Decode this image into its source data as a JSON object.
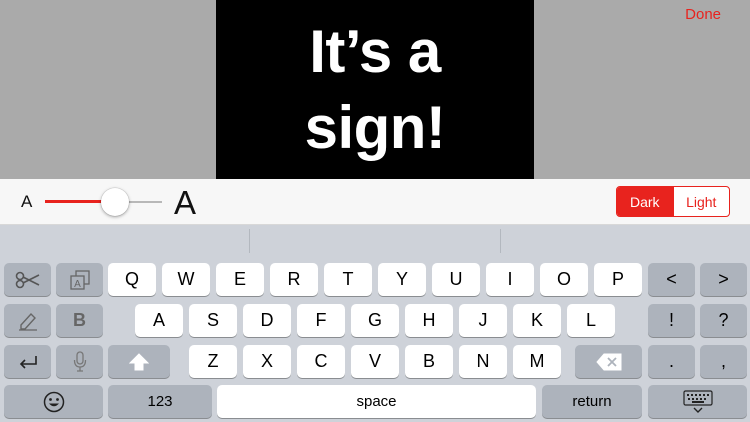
{
  "sign": {
    "text": "It’s a\nsign!"
  },
  "header": {
    "done_label": "Done"
  },
  "font_size_control": {
    "small_label": "A",
    "large_label": "A",
    "level": 0.6
  },
  "theme": {
    "dark_label": "Dark",
    "light_label": "Light",
    "selected": "Dark"
  },
  "keyboard": {
    "row1": [
      "Q",
      "W",
      "E",
      "R",
      "T",
      "Y",
      "U",
      "I",
      "O",
      "P"
    ],
    "row2": [
      "A",
      "S",
      "D",
      "F",
      "G",
      "H",
      "J",
      "K",
      "L"
    ],
    "row3": [
      "Z",
      "X",
      "C",
      "V",
      "B",
      "N",
      "M"
    ],
    "bold_label": "B",
    "exclaim_label": "!",
    "question_label": "?",
    "period_label": ".",
    "comma_label": ",",
    "numbers_label": "123",
    "space_label": "space",
    "return_label": "return",
    "left_arrow": "<",
    "right_arrow": ">"
  },
  "colors": {
    "accent": "#e8231e",
    "keyboard_bg": "#ced2d9",
    "backdrop": "#aaaaaa"
  }
}
